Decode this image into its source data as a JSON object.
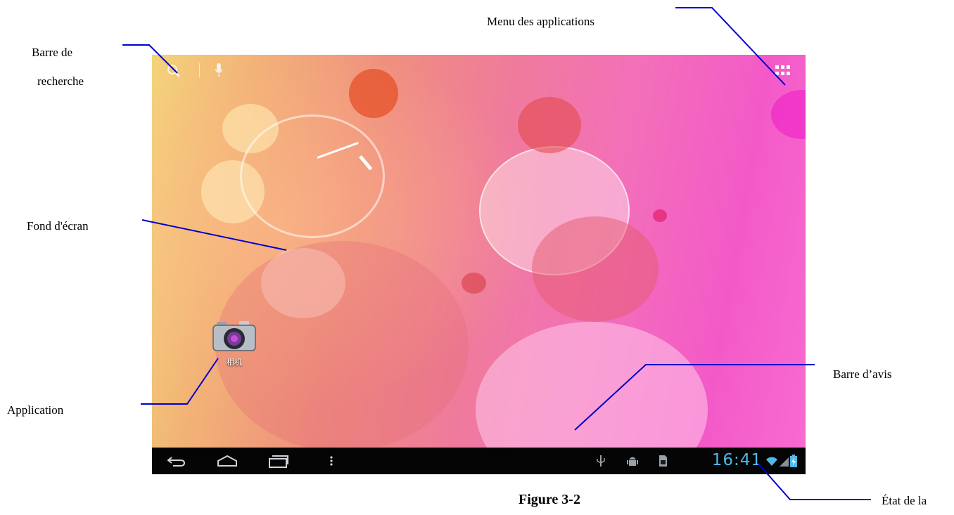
{
  "annotations": {
    "search_bar": "Barre de recherche",
    "search_bar_line1": "Barre de",
    "search_bar_line2": "recherche",
    "apps_menu": "Menu des applications",
    "wallpaper": "Fond d'écran",
    "application": "Application",
    "notification_bar": "Barre d’avis",
    "status": "État de la"
  },
  "screen": {
    "app_icon_name": "相机",
    "app_icon": "camera-icon",
    "clock": "16:41",
    "top_bar_icons": [
      "search-icon",
      "mic-icon",
      "apps-grid-icon"
    ],
    "nav_icons": [
      "back-icon",
      "home-icon",
      "recent-apps-icon",
      "menu-icon"
    ],
    "status_icons": [
      "usb-icon",
      "android-debug-icon",
      "sd-card-icon",
      "wifi-icon",
      "signal-icon",
      "battery-icon"
    ],
    "colors": {
      "clock": "#4fb8e8",
      "annotation_line": "#0000cc",
      "navbar": "#050505"
    }
  },
  "figure": {
    "caption": "Figure 3-2"
  }
}
